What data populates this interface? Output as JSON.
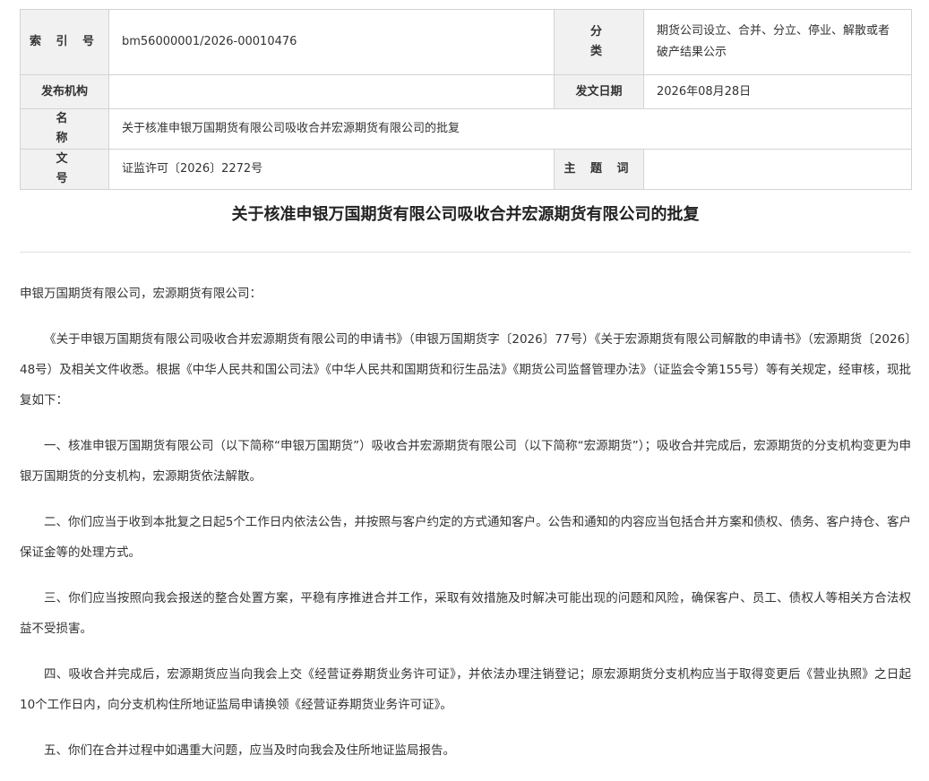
{
  "meta": {
    "index_label": "索 引 号",
    "index_value": "bm56000001/2026-00010476",
    "category_label": "分　类",
    "category_value": "期货公司设立、合并、分立、停业、解散或者破产结果公示",
    "publisher_label": "发布机构",
    "publisher_value": "",
    "date_label": "发文日期",
    "date_value": "2026年08月28日",
    "name_label": "名　称",
    "name_value": "关于核准申银万国期货有限公司吸收合并宏源期货有限公司的批复",
    "docno_label": "文　号",
    "docno_value": "证监许可〔2026〕2272号",
    "keywords_label": "主 题 词",
    "keywords_value": ""
  },
  "document": {
    "title": "关于核准申银万国期货有限公司吸收合并宏源期货有限公司的批复",
    "salutation": "申银万国期货有限公司，宏源期货有限公司：",
    "paragraphs": [
      "《关于申银万国期货有限公司吸收合并宏源期货有限公司的申请书》（申银万国期货字〔2026〕77号）《关于宏源期货有限公司解散的申请书》（宏源期货〔2026〕48号）及相关文件收悉。根据《中华人民共和国公司法》《中华人民共和国期货和衍生品法》《期货公司监督管理办法》（证监会令第155号）等有关规定，经审核，现批复如下：",
      "一、核准申银万国期货有限公司（以下简称“申银万国期货”）吸收合并宏源期货有限公司（以下简称“宏源期货”）；吸收合并完成后，宏源期货的分支机构变更为申银万国期货的分支机构，宏源期货依法解散。",
      "二、你们应当于收到本批复之日起5个工作日内依法公告，并按照与客户约定的方式通知客户。公告和通知的内容应当包括合并方案和债权、债务、客户持仓、客户保证金等的处理方式。",
      "三、你们应当按照向我会报送的整合处置方案，平稳有序推进合并工作，采取有效措施及时解决可能出现的问题和风险，确保客户、员工、债权人等相关方合法权益不受损害。",
      "四、吸收合并完成后，宏源期货应当向我会上交《经营证券期货业务许可证》，并依法办理注销登记；原宏源期货分支机构应当于取得变更后《营业执照》之日起10个工作日内，向分支机构住所地证监局申请换领《经营证券期货业务许可证》。",
      "五、你们在合并过程中如遇重大问题，应当及时向我会及住所地证监局报告。"
    ]
  }
}
